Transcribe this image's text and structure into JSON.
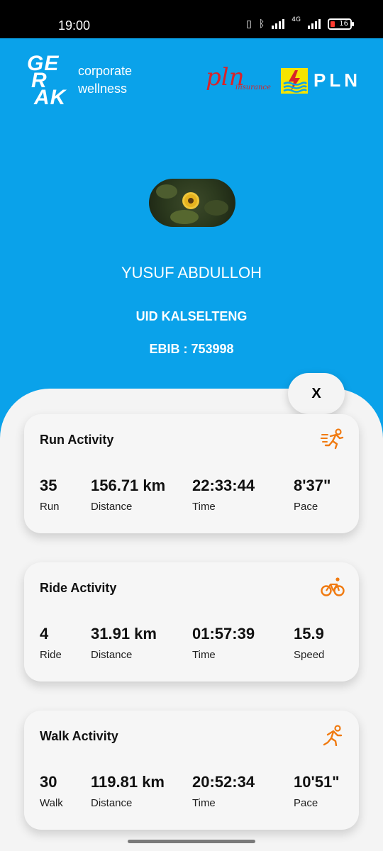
{
  "status_bar": {
    "time": "19:00",
    "network": "4G",
    "battery": "16"
  },
  "header": {
    "brand_lines": [
      "GE",
      "R",
      "AK"
    ],
    "tagline_line1": "corporate",
    "tagline_line2": "wellness",
    "partner1_big": "pln",
    "partner1_small": "insurance",
    "partner2_text": "PLN",
    "brand_blue": "#0aa2ea",
    "accent_orange": "#f07a10"
  },
  "profile": {
    "name": "YUSUF ABDULLOH",
    "unit": "UID KALSELTENG",
    "ebib": "EBIB : 753998"
  },
  "close_label": "X",
  "activities": [
    {
      "title": "Run Activity",
      "icon": "run-icon",
      "stats": [
        {
          "value": "35",
          "label": "Run"
        },
        {
          "value": "156.71 km",
          "label": "Distance"
        },
        {
          "value": "22:33:44",
          "label": "Time"
        },
        {
          "value": "8'37\"",
          "label": "Pace"
        }
      ]
    },
    {
      "title": "Ride Activity",
      "icon": "bicycle-icon",
      "stats": [
        {
          "value": "4",
          "label": "Ride"
        },
        {
          "value": "31.91 km",
          "label": "Distance"
        },
        {
          "value": "01:57:39",
          "label": "Time"
        },
        {
          "value": "15.9",
          "label": "Speed"
        }
      ]
    },
    {
      "title": "Walk Activity",
      "icon": "walk-icon",
      "stats": [
        {
          "value": "30",
          "label": "Walk"
        },
        {
          "value": "119.81 km",
          "label": "Distance"
        },
        {
          "value": "20:52:34",
          "label": "Time"
        },
        {
          "value": "10'51\"",
          "label": "Pace"
        }
      ]
    }
  ]
}
